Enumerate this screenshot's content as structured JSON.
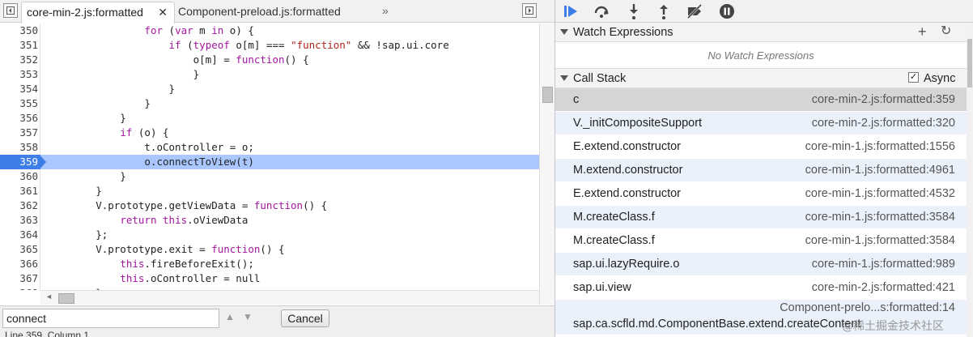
{
  "editor": {
    "tabs": [
      {
        "label": "core-min-2.js:formatted",
        "close": "✕"
      },
      {
        "label": "Component-preload.js:formatted"
      }
    ],
    "more_tabs": "»",
    "code_lines": [
      {
        "num": "350",
        "tokens": [
          {
            "t": "                "
          },
          {
            "t": "for",
            "c": "kw"
          },
          {
            "t": " ("
          },
          {
            "t": "var",
            "c": "kw"
          },
          {
            "t": " m "
          },
          {
            "t": "in",
            "c": "kw"
          },
          {
            "t": " o) {"
          }
        ]
      },
      {
        "num": "351",
        "tokens": [
          {
            "t": "                    "
          },
          {
            "t": "if",
            "c": "kw"
          },
          {
            "t": " ("
          },
          {
            "t": "typeof",
            "c": "kw"
          },
          {
            "t": " o[m] === "
          },
          {
            "t": "\"function\"",
            "c": "str"
          },
          {
            "t": " && !sap.ui.core"
          }
        ]
      },
      {
        "num": "352",
        "tokens": [
          {
            "t": "                        o[m] = "
          },
          {
            "t": "function",
            "c": "kw"
          },
          {
            "t": "() {"
          }
        ]
      },
      {
        "num": "353",
        "tokens": [
          {
            "t": "                        }"
          }
        ]
      },
      {
        "num": "354",
        "tokens": [
          {
            "t": "                    }"
          }
        ]
      },
      {
        "num": "355",
        "tokens": [
          {
            "t": "                }"
          }
        ]
      },
      {
        "num": "356",
        "tokens": [
          {
            "t": "            }"
          }
        ]
      },
      {
        "num": "357",
        "tokens": [
          {
            "t": "            "
          },
          {
            "t": "if",
            "c": "kw"
          },
          {
            "t": " (o) {"
          }
        ]
      },
      {
        "num": "358",
        "tokens": [
          {
            "t": "                t.oController = o;"
          }
        ]
      },
      {
        "num": "359",
        "tokens": [
          {
            "t": "                o.connectToView(t)"
          }
        ],
        "active": true
      },
      {
        "num": "360",
        "tokens": [
          {
            "t": "            }"
          }
        ]
      },
      {
        "num": "361",
        "tokens": [
          {
            "t": "        }"
          }
        ]
      },
      {
        "num": "362",
        "tokens": [
          {
            "t": "        V.prototype.getViewData = "
          },
          {
            "t": "function",
            "c": "kw"
          },
          {
            "t": "() {"
          }
        ]
      },
      {
        "num": "363",
        "tokens": [
          {
            "t": "            "
          },
          {
            "t": "return",
            "c": "kw"
          },
          {
            "t": " "
          },
          {
            "t": "this",
            "c": "kw"
          },
          {
            "t": ".oViewData"
          }
        ]
      },
      {
        "num": "364",
        "tokens": [
          {
            "t": "        };"
          }
        ]
      },
      {
        "num": "365",
        "tokens": [
          {
            "t": "        V.prototype.exit = "
          },
          {
            "t": "function",
            "c": "kw"
          },
          {
            "t": "() {"
          }
        ]
      },
      {
        "num": "366",
        "tokens": [
          {
            "t": "            "
          },
          {
            "t": "this",
            "c": "kw"
          },
          {
            "t": ".fireBeforeExit();"
          }
        ]
      },
      {
        "num": "367",
        "tokens": [
          {
            "t": "            "
          },
          {
            "t": "this",
            "c": "kw"
          },
          {
            "t": ".oController = null"
          }
        ]
      },
      {
        "num": "368",
        "tokens": [
          {
            "t": "        }"
          }
        ]
      }
    ],
    "search": {
      "value": "connect",
      "prev": "▲",
      "next": "▼",
      "cancel_label": "Cancel"
    },
    "status": "Line 359, Column 1"
  },
  "debugger": {
    "toolbar_icons": [
      "resume-icon",
      "step-over-icon",
      "step-into-icon",
      "step-out-icon",
      "deactivate-breakpoints-icon",
      "pause-on-exceptions-icon"
    ],
    "watch": {
      "title": "Watch Expressions",
      "add": "+",
      "refresh": "↻",
      "empty": "No Watch Expressions"
    },
    "call_stack": {
      "title": "Call Stack",
      "async_label": "Async",
      "async_checked": "✓",
      "frames": [
        {
          "fn": "c",
          "loc": "core-min-2.js:formatted:359",
          "selected": true
        },
        {
          "fn": "V._initCompositeSupport",
          "loc": "core-min-2.js:formatted:320"
        },
        {
          "fn": "E.extend.constructor",
          "loc": "core-min-1.js:formatted:1556"
        },
        {
          "fn": "M.extend.constructor",
          "loc": "core-min-1.js:formatted:4961"
        },
        {
          "fn": "E.extend.constructor",
          "loc": "core-min-1.js:formatted:4532"
        },
        {
          "fn": "M.createClass.f",
          "loc": "core-min-1.js:formatted:3584"
        },
        {
          "fn": "M.createClass.f",
          "loc": "core-min-1.js:formatted:3584"
        },
        {
          "fn": "sap.ui.lazyRequire.o",
          "loc": "core-min-1.js:formatted:989"
        },
        {
          "fn": "sap.ui.view",
          "loc": "core-min-2.js:formatted:421"
        },
        {
          "fn": "sap.ca.scfld.md.ComponentBase.extend.createContent",
          "loc": "Component-prelo...s:formatted:14",
          "tall": true
        }
      ]
    }
  },
  "watermark": "@稀土掘金技术社区",
  "colors": {
    "accent": "#3e7ee8",
    "active_line": "#aac8ff",
    "keyword": "#a3169f",
    "string": "#b1251f"
  }
}
